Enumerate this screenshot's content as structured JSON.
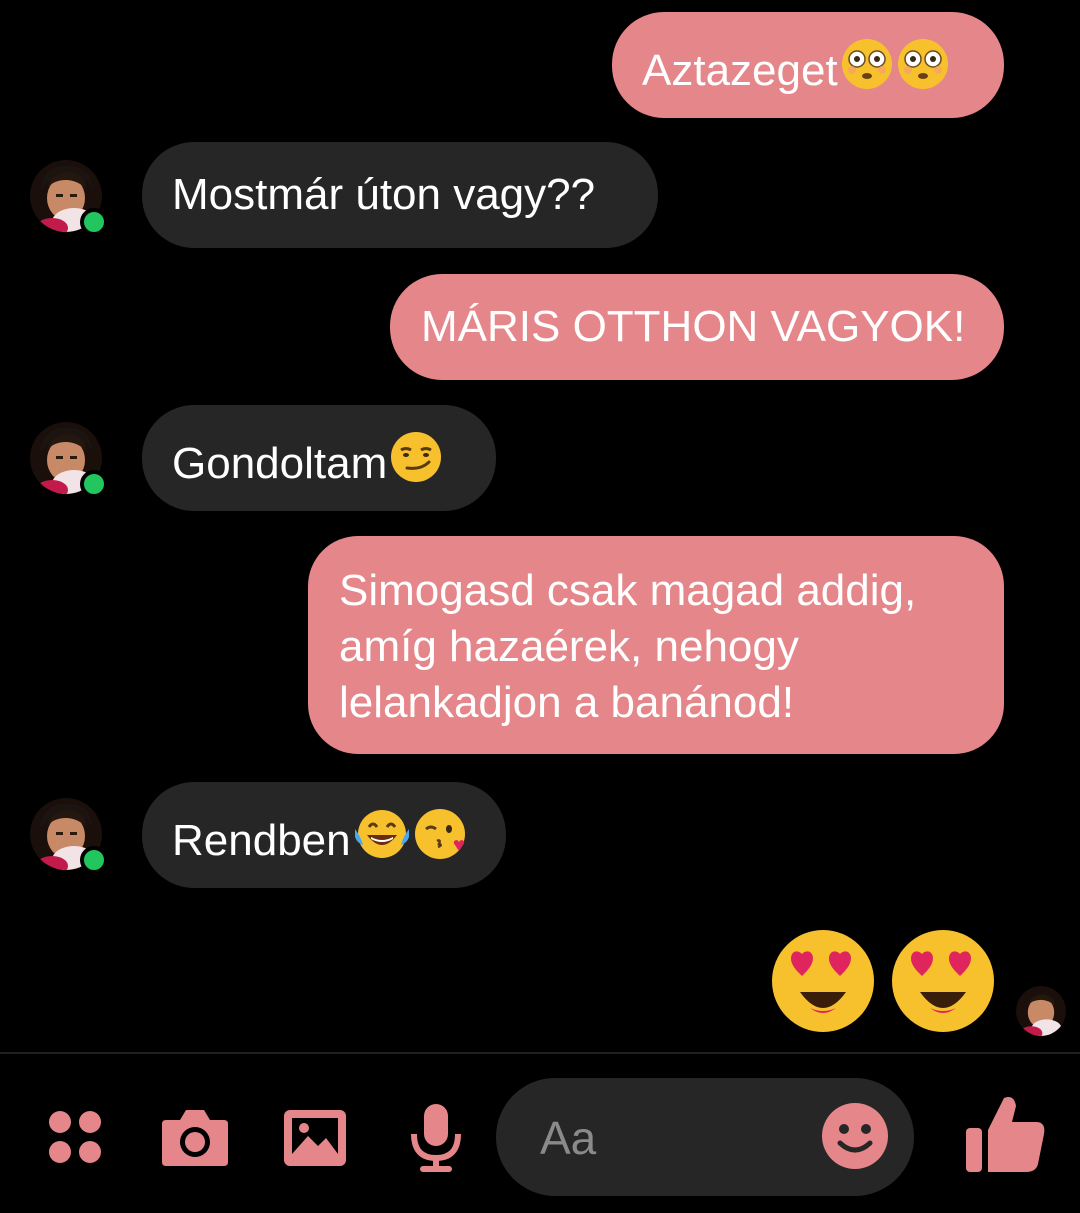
{
  "colors": {
    "outgoing_bubble": "#e5868a",
    "incoming_bubble": "#262626",
    "accent": "#e5868a",
    "presence": "#22c55e",
    "background": "#000000"
  },
  "messages": [
    {
      "direction": "outgoing",
      "text": "Aztazeget",
      "emojis": [
        "flushed-face-icon",
        "flushed-face-icon"
      ]
    },
    {
      "direction": "incoming",
      "text": "Mostmár úton vagy??",
      "emojis": []
    },
    {
      "direction": "outgoing",
      "text": "MÁRIS OTTHON VAGYOK!",
      "emojis": []
    },
    {
      "direction": "incoming",
      "text": "Gondoltam",
      "emojis": [
        "smirking-face-icon"
      ]
    },
    {
      "direction": "outgoing",
      "lines": [
        "Simogasd csak magad addig,",
        "amíg hazaérek, nehogy",
        "lelankadjon a banánod!"
      ],
      "emojis": []
    },
    {
      "direction": "incoming",
      "text": "Rendben",
      "emojis": [
        "tears-of-joy-icon",
        "face-blowing-kiss-icon"
      ]
    },
    {
      "direction": "outgoing",
      "text": "",
      "emojis": [
        "heart-eyes-icon",
        "heart-eyes-icon"
      ]
    }
  ],
  "composer": {
    "placeholder": "Aa",
    "icons": [
      "apps-icon",
      "camera-icon",
      "gallery-icon",
      "microphone-icon",
      "emoji-icon",
      "thumbs-up-icon"
    ]
  }
}
